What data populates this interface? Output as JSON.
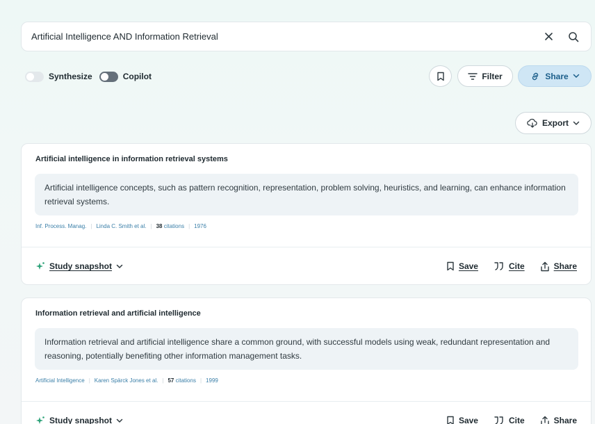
{
  "search": {
    "value": "Artificial Intelligence AND Information Retrieval",
    "clear_icon": "close-icon",
    "search_icon": "search-icon"
  },
  "toggles": {
    "synthesize_label": "Synthesize",
    "synthesize_on": false,
    "copilot_label": "Copilot",
    "copilot_on": false
  },
  "toolbar": {
    "filter_label": "Filter",
    "share_label": "Share",
    "export_label": "Export"
  },
  "colors": {
    "accent": "#1b5e8a",
    "share_bg": "#cfe6f5",
    "snapshot_icon": "#2fa37a"
  },
  "results": [
    {
      "title": "Artificial intelligence in information retrieval systems",
      "summary": "Artificial intelligence concepts, such as pattern recognition, representation, problem solving, heuristics, and learning, can enhance information retrieval systems.",
      "journal": "Inf. Process. Manag.",
      "authors": "Linda C. Smith et al.",
      "citations": "38",
      "citations_label": "citations",
      "year": "1976",
      "snapshot_label": "Study snapshot",
      "save_label": "Save",
      "cite_label": "Cite",
      "share_label": "Share"
    },
    {
      "title": "Information retrieval and artificial intelligence",
      "summary": "Information retrieval and artificial intelligence share a common ground, with successful models using weak, redundant representation and reasoning, potentially benefiting other information management tasks.",
      "journal": "Artificial Intelligence",
      "authors": "Karen Spärck Jones et al.",
      "citations": "57",
      "citations_label": "citations",
      "year": "1999",
      "snapshot_label": "Study snapshot",
      "save_label": "Save",
      "cite_label": "Cite",
      "share_label": "Share"
    }
  ]
}
